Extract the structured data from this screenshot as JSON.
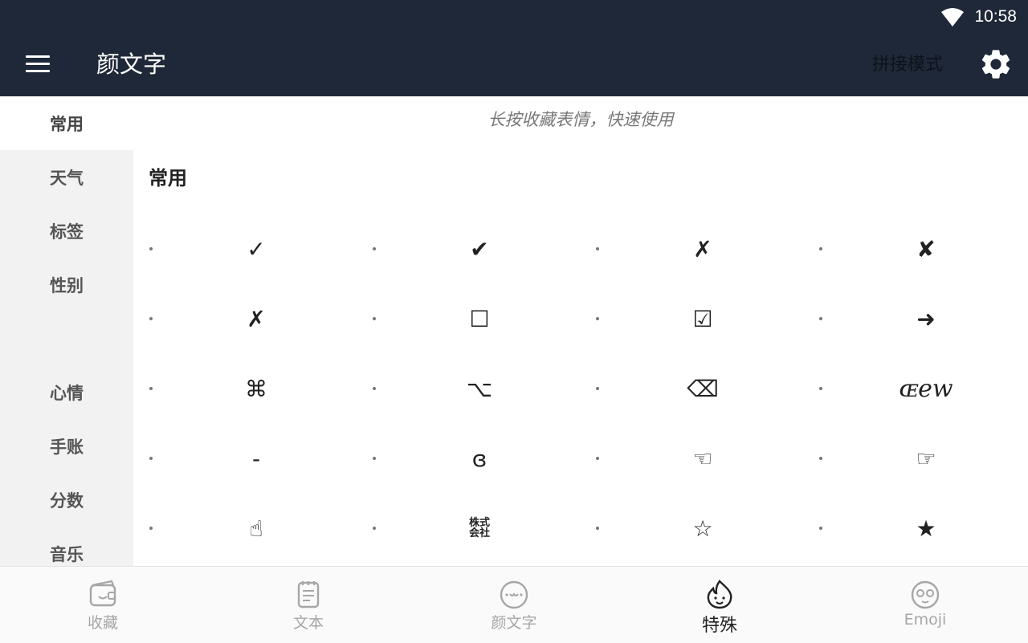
{
  "status_bar": {
    "time": "10:58"
  },
  "app_bar": {
    "title": "颜文字",
    "mode_label": "拼接模式"
  },
  "sidebar": {
    "items": [
      {
        "label": "常用",
        "active": true
      },
      {
        "label": "天气"
      },
      {
        "label": "标签"
      },
      {
        "label": "性别"
      },
      {
        "label": ""
      },
      {
        "label": "心情"
      },
      {
        "label": "手账"
      },
      {
        "label": "分数"
      },
      {
        "label": "音乐"
      }
    ]
  },
  "content": {
    "hint": "长按收藏表情，快速使用",
    "section_title": "常用",
    "symbols": [
      "✓",
      "✔",
      "✗",
      "✘",
      "✗",
      "☐",
      "☑",
      "➜",
      "⌘",
      "⌥",
      "⌫",
      "ɶew",
      "-",
      "ɞ",
      "☜",
      "☞",
      "☝",
      "株式会社",
      "☆",
      "★"
    ]
  },
  "bottom_nav": {
    "tabs": [
      {
        "label": "收藏",
        "icon": "wallet-icon"
      },
      {
        "label": "文本",
        "icon": "notes-icon"
      },
      {
        "label": "颜文字",
        "icon": "kaomoji-face-icon"
      },
      {
        "label": "特殊",
        "icon": "flame-face-icon",
        "active": true
      },
      {
        "label": "Emoji",
        "icon": "emoji-face-icon"
      }
    ]
  },
  "colors": {
    "app_bar": "#1f2838",
    "sidebar_bg": "#f2f2f2",
    "active_text": "#222222",
    "inactive_text": "#a6a6a6"
  }
}
